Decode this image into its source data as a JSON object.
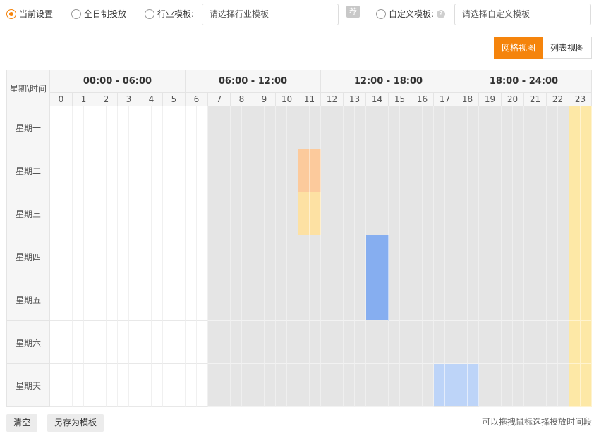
{
  "options": {
    "current": "当前设置",
    "fullday": "全日制投放",
    "industry_label": "行业模板:",
    "industry_placeholder": "请选择行业模板",
    "recommend": "荐",
    "custom_label": "自定义模板:",
    "custom_placeholder": "请选择自定义模板"
  },
  "view_toggle": {
    "grid": "网格视图",
    "list": "列表视图"
  },
  "table": {
    "corner": "星期\\时间",
    "periods": [
      "00:00 - 06:00",
      "06:00 - 12:00",
      "12:00 - 18:00",
      "18:00 - 24:00"
    ],
    "hours": [
      "0",
      "1",
      "2",
      "3",
      "4",
      "5",
      "6",
      "7",
      "8",
      "9",
      "10",
      "11",
      "12",
      "13",
      "14",
      "15",
      "16",
      "17",
      "18",
      "19",
      "20",
      "21",
      "22",
      "23"
    ],
    "days": [
      "星期一",
      "星期二",
      "星期三",
      "星期四",
      "星期五",
      "星期六",
      "星期天"
    ],
    "selected_hour_range": [
      7,
      22
    ],
    "colored": [
      {
        "day": 0,
        "hour_start": 23,
        "hour_end": 23,
        "color": "yellow"
      },
      {
        "day": 1,
        "hour_start": 11,
        "hour_end": 11,
        "color": "orange"
      },
      {
        "day": 1,
        "hour_start": 23,
        "hour_end": 23,
        "color": "yellow"
      },
      {
        "day": 2,
        "hour_start": 11,
        "hour_end": 11,
        "color": "amber"
      },
      {
        "day": 2,
        "hour_start": 23,
        "hour_end": 23,
        "color": "yellow"
      },
      {
        "day": 3,
        "hour_start": 14,
        "hour_end": 14,
        "color": "blue"
      },
      {
        "day": 3,
        "hour_start": 23,
        "hour_end": 23,
        "color": "yellow"
      },
      {
        "day": 4,
        "hour_start": 14,
        "hour_end": 14,
        "color": "blue"
      },
      {
        "day": 4,
        "hour_start": 23,
        "hour_end": 23,
        "color": "yellow"
      },
      {
        "day": 5,
        "hour_start": 23,
        "hour_end": 23,
        "color": "yellow"
      },
      {
        "day": 6,
        "hour_start": 17,
        "hour_end": 18,
        "color": "lightblue"
      },
      {
        "day": 6,
        "hour_start": 23,
        "hour_end": 23,
        "color": "yellow"
      }
    ]
  },
  "colors": {
    "accent": "#f5840c",
    "selected": "#e5e5e5",
    "orange": "#fcca9c",
    "amber": "#fde1a3",
    "yellow": "#fde8a6",
    "blue": "#86aef0",
    "lightblue": "#bdd4f8"
  },
  "footer": {
    "clear": "清空",
    "save_template": "另存为模板",
    "hint": "可以拖拽鼠标选择投放时间段"
  }
}
